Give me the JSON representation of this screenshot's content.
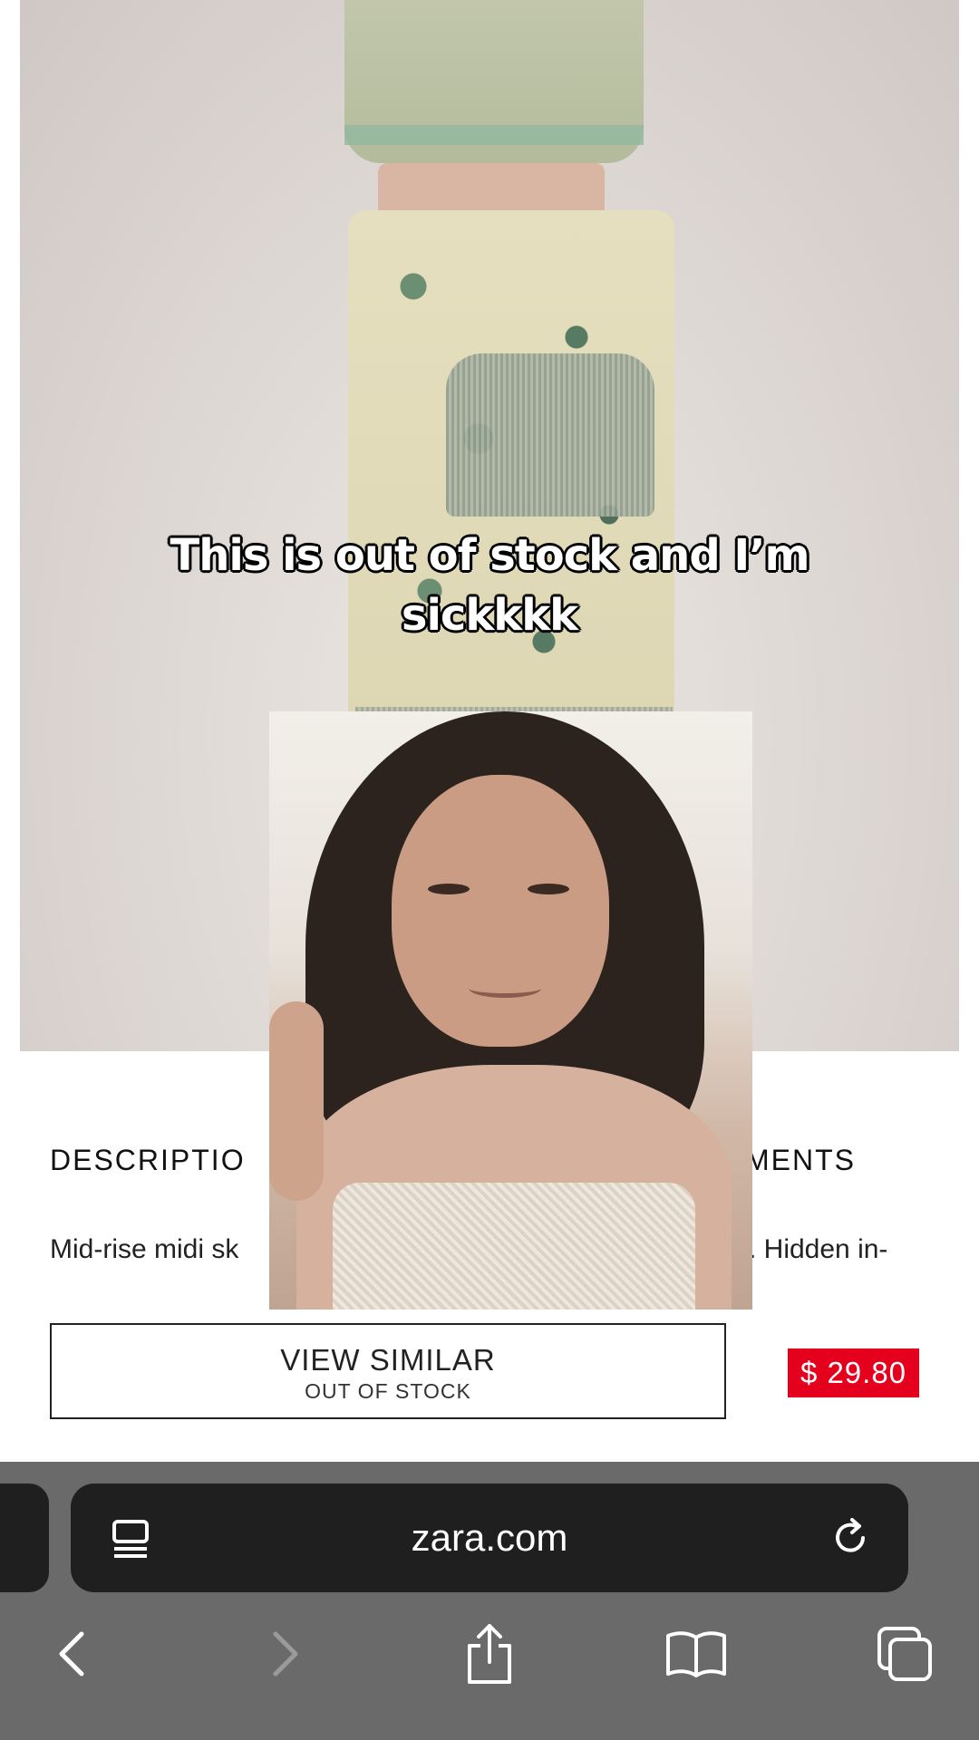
{
  "caption": {
    "line1": "This is out of stock and I’m",
    "line2": "sickkkk"
  },
  "product": {
    "description_heading": "DESCRIPTIO",
    "measurements_heading": "MENTS",
    "description_text_left": "Mid-rise midi sk",
    "description_text_right": ". Hidden in-",
    "view_similar_label": "VIEW SIMILAR",
    "stock_status": "OUT OF STOCK",
    "price": "$ 29.80"
  },
  "browser": {
    "url": "zara.com",
    "icons": {
      "reader": "reader-mode-icon",
      "reload": "reload-icon",
      "back": "back-arrow-icon",
      "forward": "forward-arrow-icon",
      "share": "share-icon",
      "bookmarks": "bookmarks-icon",
      "tabs": "tabs-icon"
    }
  },
  "colors": {
    "price_bg": "#e5001e",
    "chrome_bg": "#6a6a6a",
    "url_bar_bg": "#1f1f1f"
  }
}
